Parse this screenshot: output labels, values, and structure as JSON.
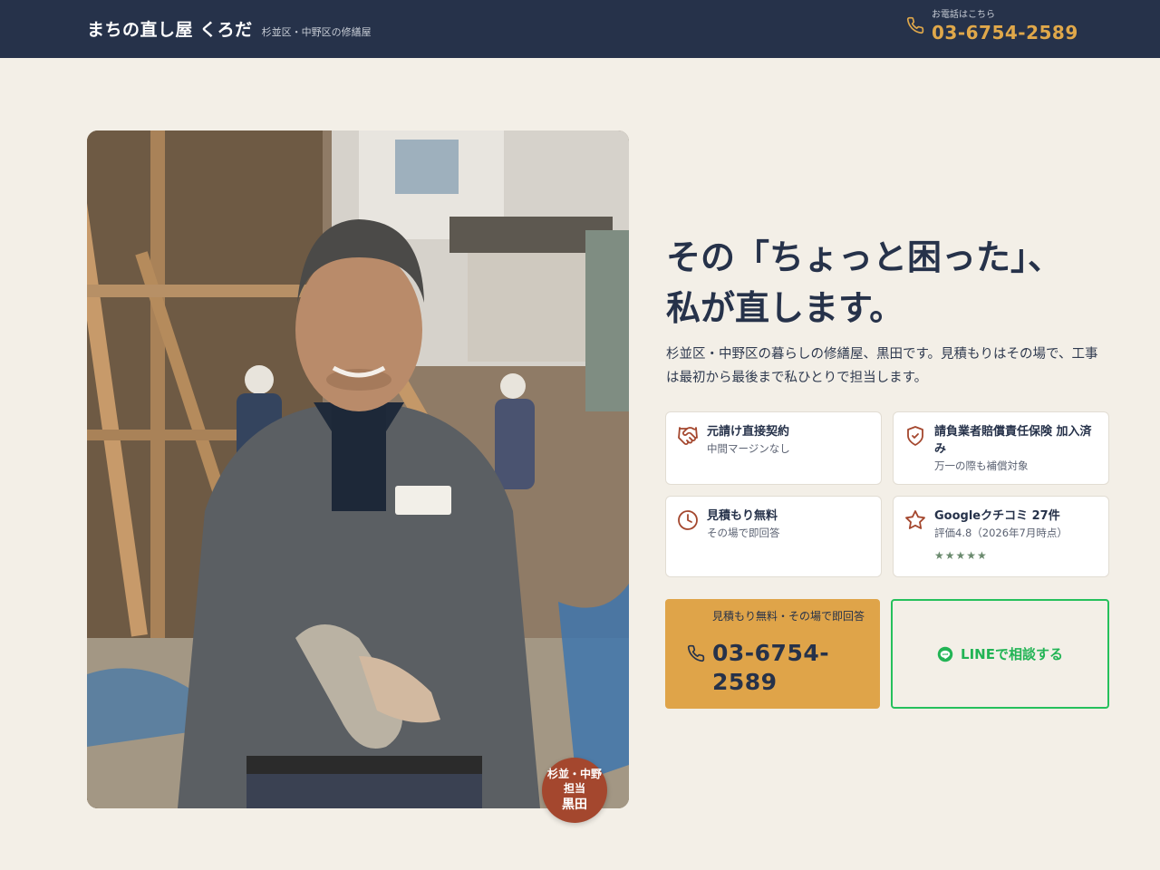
{
  "header": {
    "brand_name": "まちの直し屋 くろだ",
    "brand_sub": "杉並区・中野区の修繕屋",
    "tel_caption": "お電話はこちら",
    "tel_number": "03-6754-2589"
  },
  "photo": {
    "alt": "作業着姿の職人",
    "badge_line1": "杉並・中野",
    "badge_line2": "担当",
    "badge_line3": "黒田"
  },
  "hero": {
    "title_line1": "その「ちょっと困った」、",
    "title_line2": "私が直します。",
    "description": "杉並区・中野区の暮らしの修繕屋、黒田です。見積もりはその場で、工事は最初から最後まで私ひとりで担当します。"
  },
  "features": [
    {
      "icon": "handshake-icon",
      "title": "元請け直接契約",
      "desc": "中間マージンなし"
    },
    {
      "icon": "shield-check-icon",
      "title": "請負業者賠償責任保険 加入済み",
      "desc": "万一の際も補償対象"
    },
    {
      "icon": "clock-icon",
      "title": "見積もり無料",
      "desc": "その場で即回答"
    },
    {
      "icon": "star-icon",
      "title": "Googleクチコミ 27件",
      "desc": "評価4.8（2026年7月時点）",
      "stars": "★★★★★"
    }
  ],
  "cta": {
    "tel_caption": "見積もり無料・その場で即回答",
    "tel_number": "03-6754-2589",
    "line_label": "LINEで相談する"
  },
  "colors": {
    "header_bg": "#26324a",
    "page_bg": "#f3efe7",
    "accent_gold": "#dfa449",
    "accent_rust": "#a4472e",
    "line_green": "#22b455"
  }
}
